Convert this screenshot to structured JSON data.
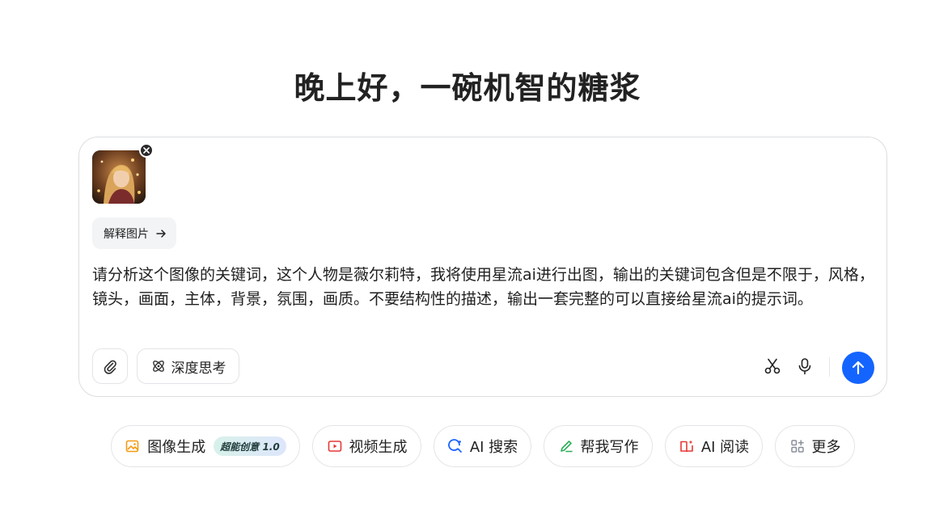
{
  "greeting": "晚上好，一碗机智的糖浆",
  "composer": {
    "attachment": {
      "remove_label": "×"
    },
    "explain_chip": {
      "label": "解释图片",
      "arrow": "→"
    },
    "prompt_text": "请分析这个图像的关键词，这个人物是薇尔莉特，我将使用星流ai进行出图，输出的关键词包含但是不限于，风格，镜头，画面，主体，背景，氛围，画质。不要结构性的描述，输出一套完整的可以直接给星流ai的提示词。",
    "deep_think_label": "深度思考",
    "send_color": "#1464ff"
  },
  "quick_actions": [
    {
      "label": "图像生成",
      "badge": "超能创意 1.0",
      "icon": "image-gen-icon",
      "color": "#f39c12"
    },
    {
      "label": "视频生成",
      "icon": "video-gen-icon",
      "color": "#e53935"
    },
    {
      "label": "AI 搜索",
      "icon": "ai-search-icon",
      "color": "#1e63ff"
    },
    {
      "label": "帮我写作",
      "icon": "writing-icon",
      "color": "#2eae5a"
    },
    {
      "label": "AI 阅读",
      "icon": "ai-read-icon",
      "color": "#e53935"
    },
    {
      "label": "更多",
      "icon": "more-icon",
      "color": "#8a8f99"
    }
  ]
}
